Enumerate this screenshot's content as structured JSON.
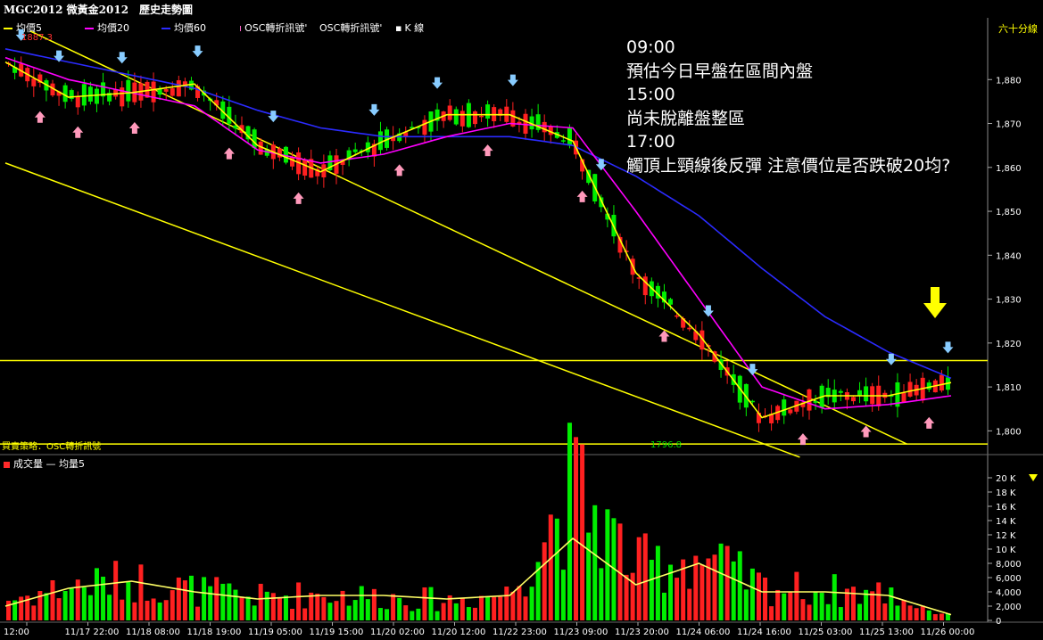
{
  "window": {
    "title": "MGC2012 微黃金2012　歷史走勢圖",
    "period": "六十分線",
    "high_label": "1887.3",
    "low_label": "1796.8",
    "strategy_label": "買賣策略：OSC轉折訊號"
  },
  "legend": [
    {
      "label": "均價5",
      "color": "#ffff00"
    },
    {
      "label": "均價20",
      "color": "#ff00ff"
    },
    {
      "label": "均價60",
      "color": "#2b2bff"
    },
    {
      "label": "OSC轉折訊號'",
      "color": "#ff66cc"
    },
    {
      "label": "OSC轉折訊號'",
      "color": "#66b3ff"
    },
    {
      "label": "K 線",
      "color": "#ffffff"
    }
  ],
  "volume_legend": "成交量 — 均量5",
  "annotations": [
    "09:00",
    "預估今日早盤在區間內盤",
    "15:00",
    "尚未脫離盤整區",
    "17:00",
    "觸頂上頸線後反彈 注意價位是否跌破20均?"
  ],
  "colors": {
    "up": "#ff2020",
    "down": "#00ee00",
    "ma5": "#ffff00",
    "ma20": "#ff00ff",
    "ma60": "#2b2bff",
    "trendline": "#ffff00",
    "buy_arrow": "#ff99bb",
    "sell_arrow": "#88ccff"
  },
  "chart_data": {
    "type": "line",
    "price_axis": {
      "ticks": [
        "1,880",
        "1,870",
        "1,860",
        "1,850",
        "1,840",
        "1,830",
        "1,820",
        "1,810",
        "1,800"
      ],
      "range": [
        1795,
        1890
      ]
    },
    "volume_axis": {
      "ticks": [
        "20 K",
        "18 K",
        "16 K",
        "14 K",
        "12 K",
        "10 K",
        "8,000",
        "6,000",
        "4,000",
        "2,000",
        "0"
      ],
      "range": [
        0,
        21000
      ]
    },
    "x_labels": [
      "12:00",
      "11/17 22:00",
      "11/18 08:00",
      "11/18 19:00",
      "11/19 05:00",
      "11/19 15:00",
      "11/20 02:00",
      "11/20 12:00",
      "11/22 23:00",
      "11/23 09:00",
      "11/23 20:00",
      "11/24 06:00",
      "11/24 16:00",
      "11/25 03:00",
      "11/25 13:00",
      "11/26 00:00"
    ],
    "series": [
      {
        "name": "均價5",
        "x": [
          0,
          10,
          20,
          30,
          40,
          50,
          60,
          70,
          80,
          90,
          100,
          110,
          120,
          130,
          140,
          150
        ],
        "values": [
          1884,
          1876,
          1877,
          1879,
          1865,
          1859,
          1866,
          1872,
          1872,
          1866,
          1836,
          1822,
          1803,
          1808,
          1808,
          1811
        ]
      },
      {
        "name": "均價20",
        "x": [
          0,
          10,
          20,
          30,
          40,
          50,
          60,
          70,
          80,
          90,
          100,
          110,
          120,
          130,
          140,
          150
        ],
        "values": [
          1885,
          1880,
          1877,
          1874,
          1864,
          1861,
          1863,
          1867,
          1870,
          1869,
          1850,
          1830,
          1810,
          1805,
          1806,
          1808
        ]
      },
      {
        "name": "均價60",
        "x": [
          0,
          10,
          20,
          30,
          40,
          50,
          60,
          70,
          80,
          90,
          100,
          110,
          120,
          130,
          140,
          150
        ],
        "values": [
          1887,
          1884,
          1881,
          1878,
          1873,
          1869,
          1867,
          1867,
          1867,
          1865,
          1858,
          1849,
          1837,
          1826,
          1818,
          1812
        ]
      },
      {
        "name": "成交量",
        "x": [
          0,
          10,
          20,
          30,
          40,
          50,
          60,
          70,
          80,
          90,
          100,
          110,
          120,
          130,
          140,
          150
        ],
        "values": [
          3000,
          5000,
          6000,
          4500,
          3500,
          4000,
          3500,
          3000,
          4000,
          20000,
          8000,
          9500,
          5000,
          4500,
          4000,
          500
        ]
      },
      {
        "name": "均量5",
        "x": [
          0,
          10,
          20,
          30,
          40,
          50,
          60,
          70,
          80,
          90,
          100,
          110,
          120,
          130,
          140,
          150
        ],
        "values": [
          2000,
          4500,
          5500,
          4000,
          3000,
          3500,
          3500,
          3000,
          3500,
          11500,
          5000,
          8000,
          4000,
          4000,
          3500,
          800
        ]
      }
    ],
    "horizontal_lines": [
      1816,
      1797
    ],
    "trendlines": [
      {
        "from": [
          4,
          1891
        ],
        "to": [
          143,
          1797
        ]
      },
      {
        "from": [
          0,
          1861
        ],
        "to": [
          126,
          1794
        ]
      }
    ],
    "grid": false,
    "legend_position": "top-left"
  }
}
